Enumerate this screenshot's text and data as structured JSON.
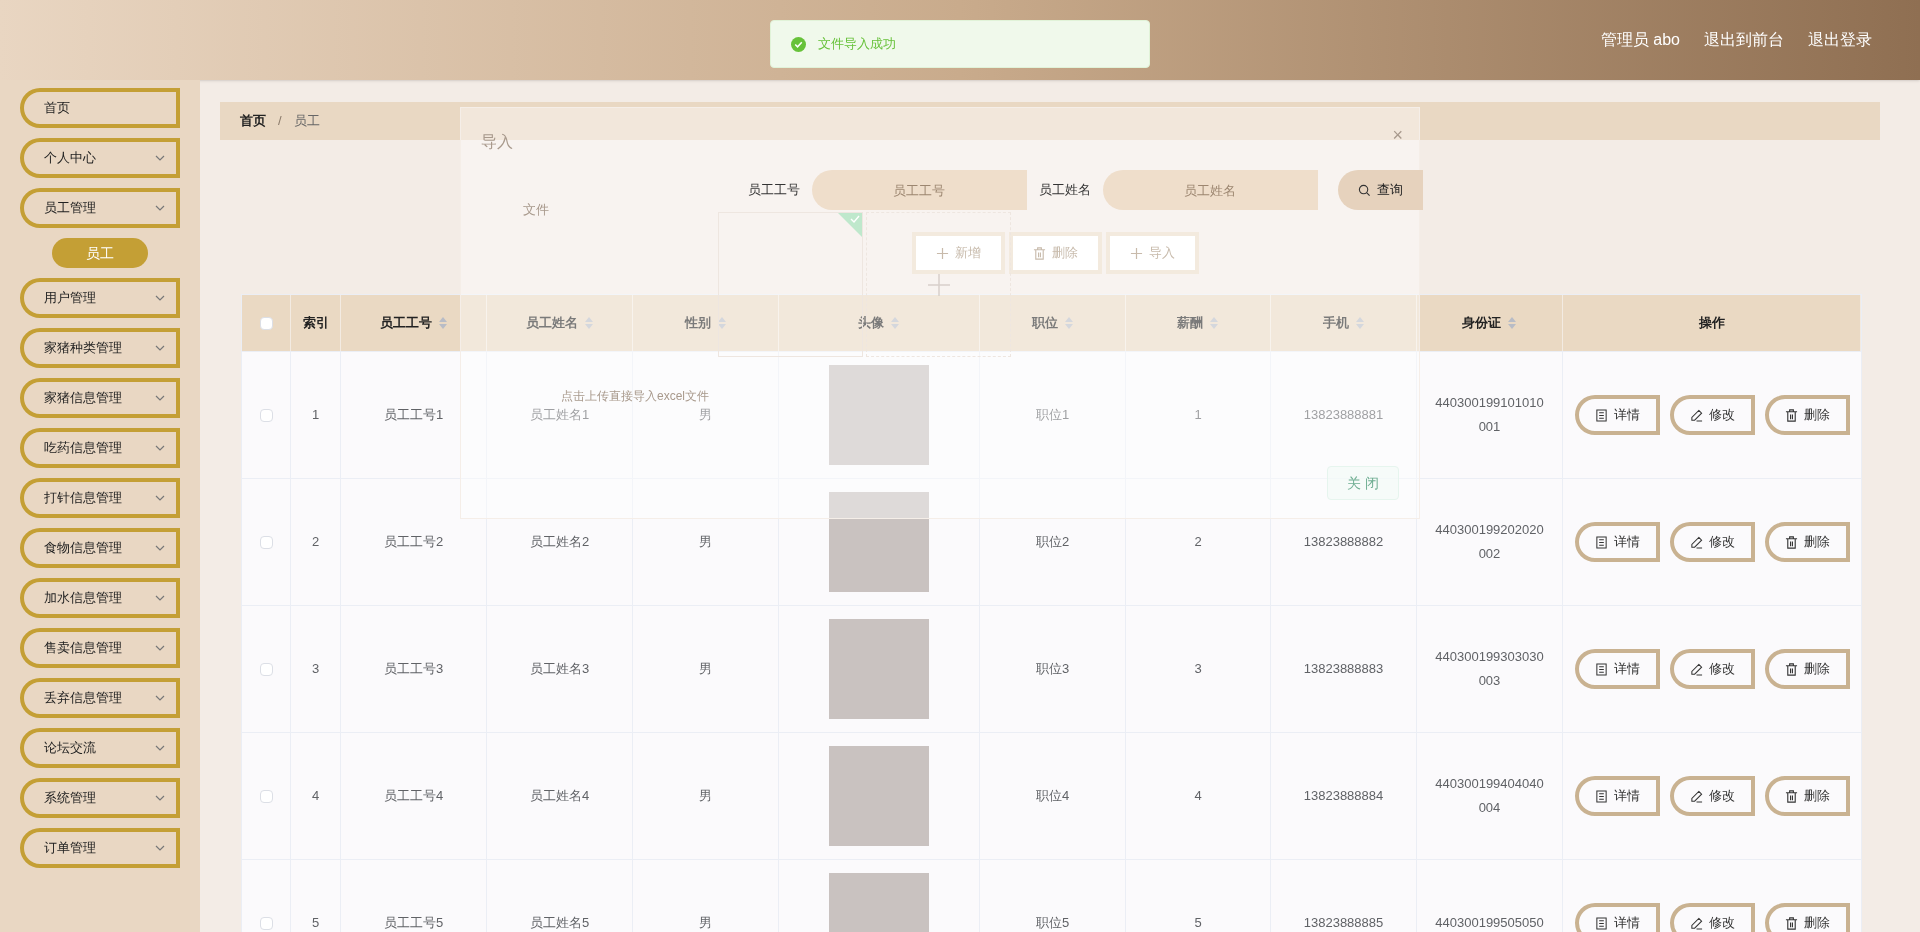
{
  "toast": {
    "text": "文件导入成功"
  },
  "header": {
    "links": [
      "管理员 abo",
      "退出到前台",
      "退出登录"
    ]
  },
  "sidebar": {
    "items": [
      {
        "label": "首页",
        "expandable": false
      },
      {
        "label": "个人中心",
        "expandable": true
      },
      {
        "label": "员工管理",
        "expandable": true,
        "children": [
          {
            "label": "员工",
            "selected": true
          }
        ]
      },
      {
        "label": "用户管理",
        "expandable": true
      },
      {
        "label": "家猪种类管理",
        "expandable": true
      },
      {
        "label": "家猪信息管理",
        "expandable": true
      },
      {
        "label": "吃药信息管理",
        "expandable": true
      },
      {
        "label": "打针信息管理",
        "expandable": true
      },
      {
        "label": "食物信息管理",
        "expandable": true
      },
      {
        "label": "加水信息管理",
        "expandable": true
      },
      {
        "label": "售卖信息管理",
        "expandable": true
      },
      {
        "label": "丢弃信息管理",
        "expandable": true
      },
      {
        "label": "论坛交流",
        "expandable": true
      },
      {
        "label": "系统管理",
        "expandable": true
      },
      {
        "label": "订单管理",
        "expandable": true
      }
    ]
  },
  "breadcrumb": {
    "items": [
      "首页",
      "员工"
    ],
    "separator": "/"
  },
  "search": {
    "fields": [
      {
        "label": "员工工号",
        "placeholder": "员工工号"
      },
      {
        "label": "员工姓名",
        "placeholder": "员工姓名"
      }
    ],
    "button": "查询"
  },
  "actions": [
    {
      "kind": "add",
      "label": "新增"
    },
    {
      "kind": "delete",
      "label": "删除"
    },
    {
      "kind": "import",
      "label": "导入"
    }
  ],
  "dialog": {
    "title": "导入",
    "close_icon": "×",
    "file_label": "文件",
    "hint": "点击上传直接导入excel文件",
    "close_button": "关 闭"
  },
  "table": {
    "header_checked": false,
    "columns": [
      {
        "label": "索引",
        "sortable": false
      },
      {
        "label": "员工工号",
        "sortable": true
      },
      {
        "label": "员工姓名",
        "sortable": true
      },
      {
        "label": "性别",
        "sortable": true
      },
      {
        "label": "头像",
        "sortable": true
      },
      {
        "label": "职位",
        "sortable": true
      },
      {
        "label": "薪酬",
        "sortable": true
      },
      {
        "label": "手机",
        "sortable": true
      },
      {
        "label": "身份证",
        "sortable": true
      },
      {
        "label": "操作",
        "sortable": false
      }
    ],
    "rows": [
      {
        "checked": false,
        "index": "1",
        "id": "员工工号1",
        "name": "员工姓名1",
        "gender": "男",
        "position": "职位1",
        "salary": "1",
        "phone": "13823888881",
        "idcard": "440300199101010001",
        "actions": [
          {
            "kind": "detail",
            "label": "详情"
          },
          {
            "kind": "edit",
            "label": "修改"
          },
          {
            "kind": "delete",
            "label": "删除"
          }
        ]
      },
      {
        "checked": false,
        "index": "2",
        "id": "员工工号2",
        "name": "员工姓名2",
        "gender": "男",
        "position": "职位2",
        "salary": "2",
        "phone": "13823888882",
        "idcard": "440300199202020002",
        "actions": [
          {
            "kind": "detail",
            "label": "详情"
          },
          {
            "kind": "edit",
            "label": "修改"
          },
          {
            "kind": "delete",
            "label": "删除"
          }
        ]
      },
      {
        "checked": false,
        "index": "3",
        "id": "员工工号3",
        "name": "员工姓名3",
        "gender": "男",
        "position": "职位3",
        "salary": "3",
        "phone": "13823888883",
        "idcard": "440300199303030003",
        "actions": [
          {
            "kind": "detail",
            "label": "详情"
          },
          {
            "kind": "edit",
            "label": "修改"
          },
          {
            "kind": "delete",
            "label": "删除"
          }
        ]
      },
      {
        "checked": false,
        "index": "4",
        "id": "员工工号4",
        "name": "员工姓名4",
        "gender": "男",
        "position": "职位4",
        "salary": "4",
        "phone": "13823888884",
        "idcard": "440300199404040004",
        "actions": [
          {
            "kind": "detail",
            "label": "详情"
          },
          {
            "kind": "edit",
            "label": "修改"
          },
          {
            "kind": "delete",
            "label": "删除"
          }
        ]
      },
      {
        "checked": false,
        "index": "5",
        "id": "员工工号5",
        "name": "员工姓名5",
        "gender": "男",
        "position": "职位5",
        "salary": "5",
        "phone": "13823888885",
        "idcard": "440300199505050",
        "actions": [
          {
            "kind": "detail",
            "label": "详情"
          },
          {
            "kind": "edit",
            "label": "修改"
          },
          {
            "kind": "delete",
            "label": "删除"
          }
        ]
      }
    ]
  }
}
